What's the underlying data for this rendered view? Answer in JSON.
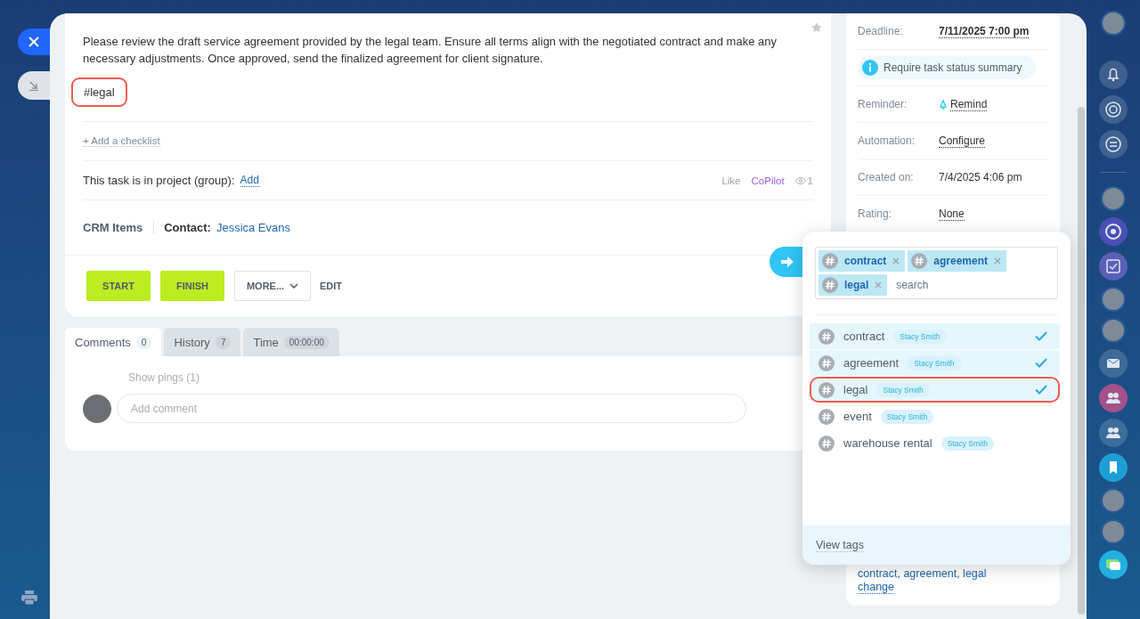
{
  "task": {
    "description": "Please review the draft service agreement provided by the legal team. Ensure all terms align with the negotiated contract and make any necessary adjustments. Once approved, send the finalized agreement for client signature.",
    "hashtag": {
      "text": "#legal",
      "highlighted": true
    },
    "add_checklist": "+ Add a checklist",
    "project_label": "This task is in project (group):",
    "project_link": "Add",
    "like": "Like",
    "copilot": "CoPilot",
    "views": "1",
    "crm": {
      "label": "CRM Items",
      "contact_label": "Contact:",
      "contact": "Jessica Evans"
    },
    "buttons": [
      {
        "label": "START",
        "kind": "primary"
      },
      {
        "label": "FINISH",
        "kind": "primary"
      },
      {
        "label": "MORE...",
        "kind": "dropdown"
      },
      {
        "label": "EDIT",
        "kind": "link"
      }
    ]
  },
  "sidebar": {
    "rows": [
      {
        "kind": "strong-link",
        "label": "Deadline:",
        "value": "7/11/2025 7:00 pm"
      },
      {
        "kind": "notice",
        "text": "Require task status summary"
      },
      {
        "kind": "icon-link",
        "label": "Reminder:",
        "value": "Remind"
      },
      {
        "kind": "link",
        "label": "Automation:",
        "value": "Configure"
      },
      {
        "kind": "text",
        "label": "Created on:",
        "value": "7/4/2025 4:06 pm"
      },
      {
        "kind": "link",
        "label": "Rating:",
        "value": "None"
      }
    ],
    "tags_text": "contract, agreement, legal",
    "change_link": "change"
  },
  "tabs": [
    {
      "label": "Comments",
      "count": "0",
      "selected": true
    },
    {
      "label": "History",
      "count": "7",
      "selected": false
    },
    {
      "label": "Time",
      "count": "00:00:00",
      "selected": false
    }
  ],
  "comments": {
    "show_pings": "Show pings (1)",
    "placeholder": "Add comment"
  },
  "tag_popup": {
    "chips": [
      "contract",
      "agreement",
      "legal"
    ],
    "search_placeholder": "search",
    "items": [
      {
        "name": "contract",
        "author": "Stacy Smith",
        "selected": true,
        "highlighted": false
      },
      {
        "name": "agreement",
        "author": "Stacy Smith",
        "selected": true,
        "highlighted": false
      },
      {
        "name": "legal",
        "author": "Stacy Smith",
        "selected": true,
        "highlighted": true
      },
      {
        "name": "event",
        "author": "Stacy Smith",
        "selected": false,
        "highlighted": false
      },
      {
        "name": "warehouse rental",
        "author": "Stacy Smith",
        "selected": false,
        "highlighted": false
      }
    ],
    "footer": "View tags"
  }
}
